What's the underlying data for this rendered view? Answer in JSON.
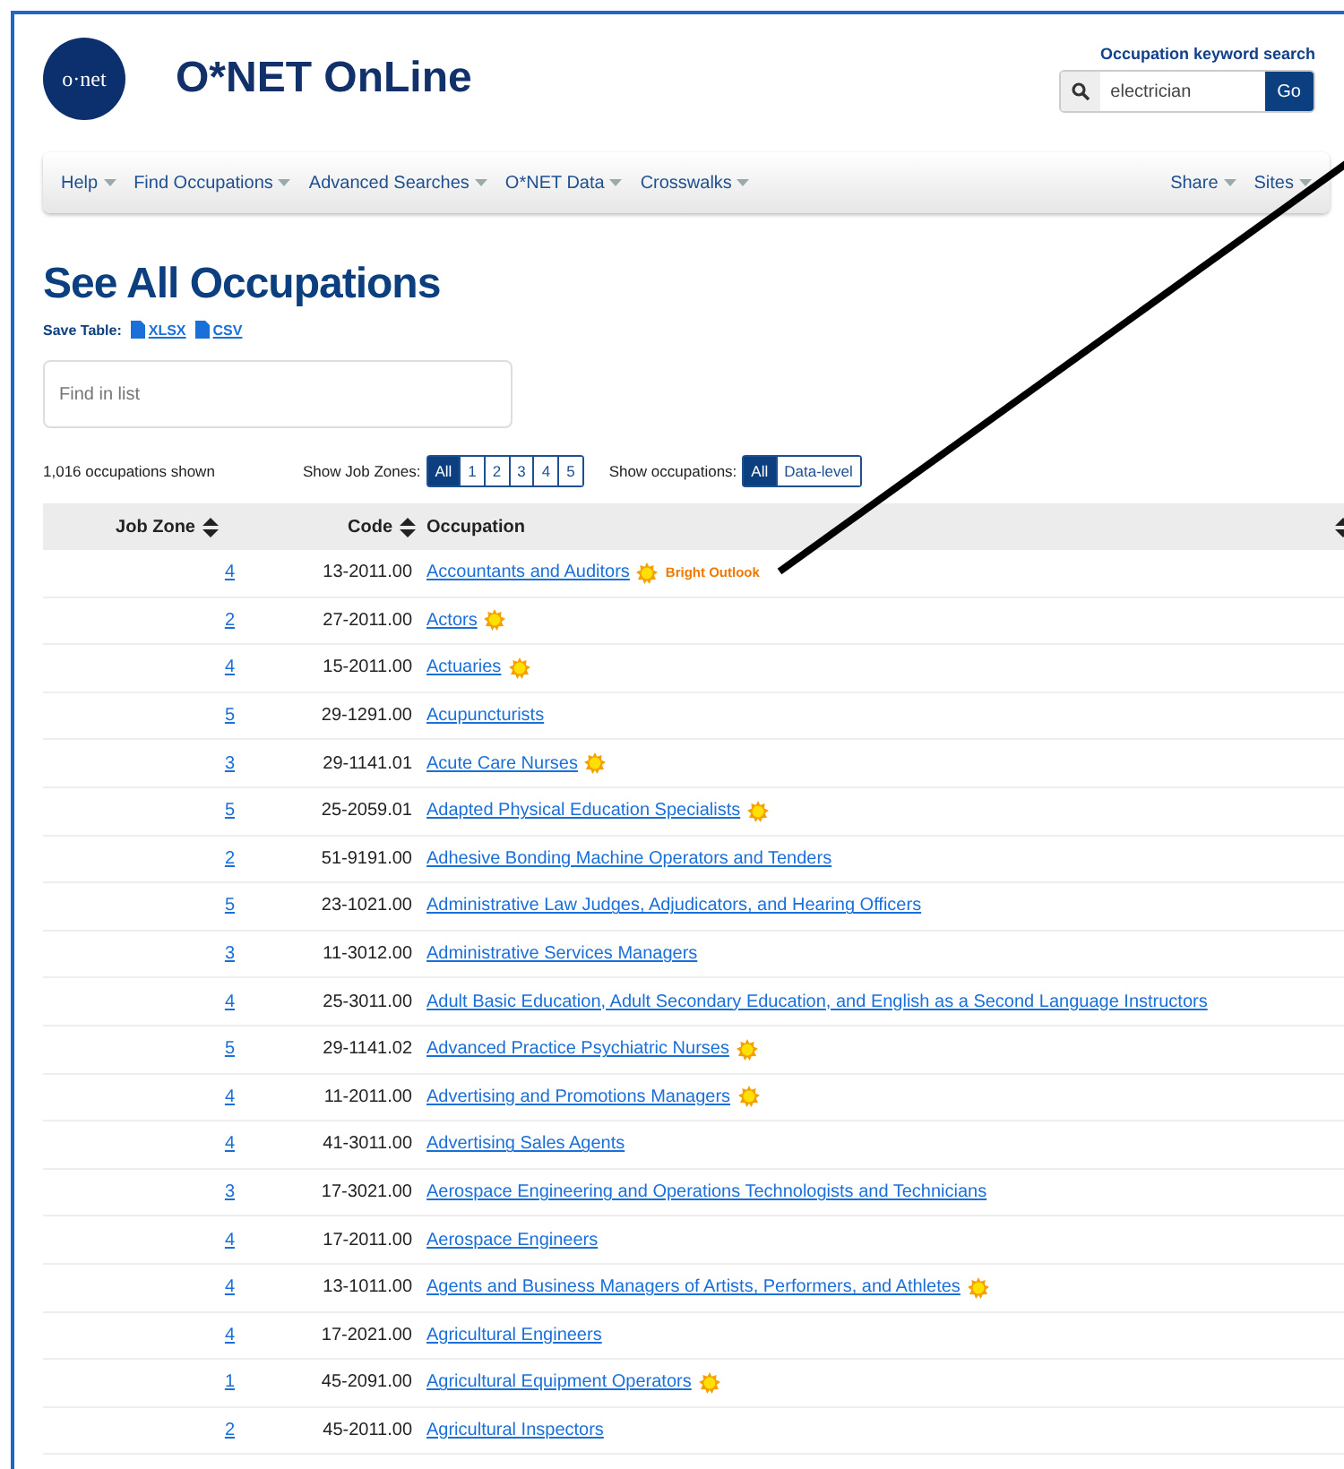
{
  "header": {
    "logo_text": "o·net",
    "site_title": "O*NET OnLine",
    "search": {
      "label": "Occupation keyword search",
      "value": "electrician",
      "button": "Go"
    }
  },
  "nav": {
    "left": [
      "Help",
      "Find Occupations",
      "Advanced Searches",
      "O*NET Data",
      "Crosswalks"
    ],
    "right": [
      "Share",
      "Sites"
    ]
  },
  "page": {
    "title": "See All Occupations",
    "save_label": "Save Table:",
    "save_links": [
      {
        "label": "XLSX"
      },
      {
        "label": "CSV"
      }
    ],
    "find": {
      "placeholder": "Find in list"
    },
    "count": "1,016 occupations shown",
    "zones_label": "Show Job Zones:",
    "zones": [
      {
        "label": "All",
        "selected": true
      },
      {
        "label": "1",
        "selected": false
      },
      {
        "label": "2",
        "selected": false
      },
      {
        "label": "3",
        "selected": false
      },
      {
        "label": "4",
        "selected": false
      },
      {
        "label": "5",
        "selected": false
      }
    ],
    "occ_label": "Show occupations:",
    "occ_filter": [
      {
        "label": "All",
        "selected": true
      },
      {
        "label": "Data-level",
        "selected": false
      }
    ]
  },
  "table": {
    "columns": [
      "Job Zone",
      "Code",
      "Occupation"
    ],
    "rows": [
      {
        "zone": "4",
        "code": "13-2011.00",
        "occupation": "Accountants and Auditors",
        "bright": true,
        "badge": "Bright Outlook"
      },
      {
        "zone": "2",
        "code": "27-2011.00",
        "occupation": "Actors",
        "bright": true
      },
      {
        "zone": "4",
        "code": "15-2011.00",
        "occupation": "Actuaries",
        "bright": true
      },
      {
        "zone": "5",
        "code": "29-1291.00",
        "occupation": "Acupuncturists",
        "bright": false
      },
      {
        "zone": "3",
        "code": "29-1141.01",
        "occupation": "Acute Care Nurses",
        "bright": true
      },
      {
        "zone": "5",
        "code": "25-2059.01",
        "occupation": "Adapted Physical Education Specialists",
        "bright": true
      },
      {
        "zone": "2",
        "code": "51-9191.00",
        "occupation": "Adhesive Bonding Machine Operators and Tenders",
        "bright": false
      },
      {
        "zone": "5",
        "code": "23-1021.00",
        "occupation": "Administrative Law Judges, Adjudicators, and Hearing Officers",
        "bright": false
      },
      {
        "zone": "3",
        "code": "11-3012.00",
        "occupation": "Administrative Services Managers",
        "bright": false
      },
      {
        "zone": "4",
        "code": "25-3011.00",
        "occupation": "Adult Basic Education, Adult Secondary Education, and English as a Second Language Instructors",
        "bright": false
      },
      {
        "zone": "5",
        "code": "29-1141.02",
        "occupation": "Advanced Practice Psychiatric Nurses",
        "bright": true
      },
      {
        "zone": "4",
        "code": "11-2011.00",
        "occupation": "Advertising and Promotions Managers",
        "bright": true
      },
      {
        "zone": "4",
        "code": "41-3011.00",
        "occupation": "Advertising Sales Agents",
        "bright": false
      },
      {
        "zone": "3",
        "code": "17-3021.00",
        "occupation": "Aerospace Engineering and Operations Technologists and Technicians",
        "bright": false
      },
      {
        "zone": "4",
        "code": "17-2011.00",
        "occupation": "Aerospace Engineers",
        "bright": false
      },
      {
        "zone": "4",
        "code": "13-1011.00",
        "occupation": "Agents and Business Managers of Artists, Performers, and Athletes",
        "bright": true
      },
      {
        "zone": "4",
        "code": "17-2021.00",
        "occupation": "Agricultural Engineers",
        "bright": false
      },
      {
        "zone": "1",
        "code": "45-2091.00",
        "occupation": "Agricultural Equipment Operators",
        "bright": true
      },
      {
        "zone": "2",
        "code": "45-2011.00",
        "occupation": "Agricultural Inspectors",
        "bright": false
      }
    ]
  }
}
